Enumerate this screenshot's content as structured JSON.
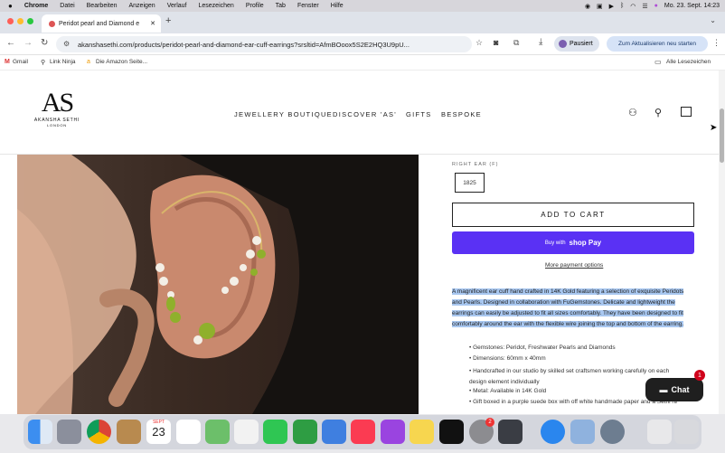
{
  "macbar": {
    "app": "Chrome",
    "menus": [
      "Datei",
      "Bearbeiten",
      "Anzeigen",
      "Verlauf",
      "Lesezeichen",
      "Profile",
      "Tab",
      "Fenster",
      "Hilfe"
    ],
    "clock": "Mo. 23. Sept. 14:23"
  },
  "tab": {
    "title": "Peridot pearl and Diamond e"
  },
  "omnibox": {
    "url": "akanshasethi.com/products/peridot-pearl-and-diamond-ear-cuff-earrings?srsltid=AfmBOoox5S2E2HQ3U9pU..."
  },
  "toolbar": {
    "profile": "Pausiert",
    "update": "Zum Aktualisieren neu starten"
  },
  "bookmarks": {
    "items": [
      "Gmail",
      "Link Ninja",
      "Die Amazon Seite..."
    ],
    "all": "Alle Lesezeichen"
  },
  "site": {
    "logo_mark": "AS",
    "logo_name": "AKANSHA SETHI",
    "logo_sub": "LONDON",
    "nav": [
      "JEWELLERY BOUTIQUE",
      "DISCOVER 'AS'",
      "GIFTS",
      "BESPOKE"
    ]
  },
  "product": {
    "option_label": "RIGHT EAR (F)",
    "option_value": "1825",
    "add_to_cart": "ADD TO CART",
    "buy_with": "Buy with",
    "shop_pay": "shop Pay",
    "more_options": "More payment options",
    "description": "A magnificent ear cuff hand crafted in 14K Gold featuring a selection of exquisite Peridots and Pearls. Designed in collaboration with FuGemstones. Delicate and lightweight the earrings can easily be adjusted to fit all sizes comfortably. They have been designed to fit comfortably around the ear with the flexible wire joining the top and bottom of the earring.",
    "bullets": [
      "Gemstones: Peridot, Freshwater Pearls and Diamonds",
      "Dimensions: 60mm x 40mm",
      "Handcrafted in our studio by skilled set craftsmen working carefully on each design element individually",
      "Metal: Available in 14K Gold",
      "Gift boxed in a purple suede box with off white handmade paper and a Sethi name"
    ]
  },
  "chat": {
    "label": "Chat",
    "badge": "1"
  },
  "dock": {
    "calendar_month": "SEPT",
    "calendar_day": "23",
    "badge": "2"
  },
  "colors": {
    "shop_pay": "#5a31f4",
    "selection": "#a8c7f0",
    "chat": "#1f1f1f"
  }
}
